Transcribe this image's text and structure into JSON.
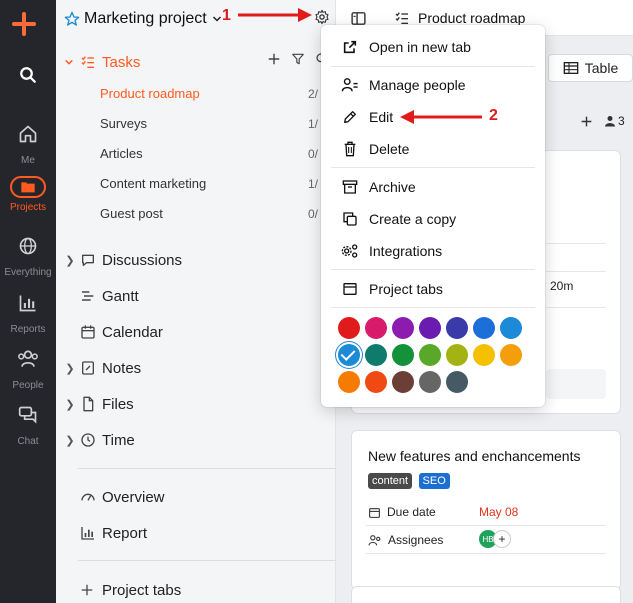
{
  "rail": {
    "items": [
      {
        "label": "Me"
      },
      {
        "label": "Projects"
      },
      {
        "label": "Everything"
      },
      {
        "label": "Reports"
      },
      {
        "label": "People"
      },
      {
        "label": "Chat"
      }
    ]
  },
  "sidebar": {
    "project_title": "Marketing project",
    "tasks_label": "Tasks",
    "task_lists": [
      {
        "label": "Product roadmap",
        "count": "2/"
      },
      {
        "label": "Surveys",
        "count": "1/"
      },
      {
        "label": "Articles",
        "count": "0/"
      },
      {
        "label": "Content marketing",
        "count": "1/"
      },
      {
        "label": "Guest post",
        "count": "0/"
      }
    ],
    "nav": [
      {
        "label": "Discussions"
      },
      {
        "label": "Gantt"
      },
      {
        "label": "Calendar"
      },
      {
        "label": "Notes"
      },
      {
        "label": "Files"
      },
      {
        "label": "Time"
      }
    ],
    "nav2": [
      {
        "label": "Overview"
      },
      {
        "label": "Report"
      }
    ],
    "project_tabs": "Project tabs"
  },
  "main": {
    "title": "Product roadmap",
    "table_label": "Table",
    "people_count": "3",
    "card1_time": "20m",
    "card2": {
      "title": "New features and enchancements",
      "tags": [
        {
          "label": "content",
          "color": "#4a4a4a"
        },
        {
          "label": "SEO",
          "color": "#1c6fd1"
        }
      ],
      "due_label": "Due date",
      "due_value": "May 08",
      "assignees_label": "Assignees",
      "avatar": "HB",
      "add": "+"
    }
  },
  "menu": {
    "items": [
      {
        "label": "Open in new tab"
      },
      {
        "label": "Manage people"
      },
      {
        "label": "Edit"
      },
      {
        "label": "Delete"
      },
      {
        "label": "Archive"
      },
      {
        "label": "Create a copy"
      },
      {
        "label": "Integrations"
      },
      {
        "label": "Project tabs"
      }
    ],
    "colors": [
      "#e01b1b",
      "#d81b6a",
      "#8e1bb0",
      "#6a1bb0",
      "#3a3aa8",
      "#1c6fd8",
      "#1c8ad6",
      "#1c8ad6",
      "#0f7b6c",
      "#13923a",
      "#5aa82a",
      "#a4b314",
      "#f5c000",
      "#f59e0b",
      "#f57c00",
      "#f04a12",
      "#6b3e36",
      "#666666",
      "#455a64"
    ],
    "selected_color": "#1c8ad6"
  },
  "annotations": {
    "one": "1",
    "two": "2"
  }
}
